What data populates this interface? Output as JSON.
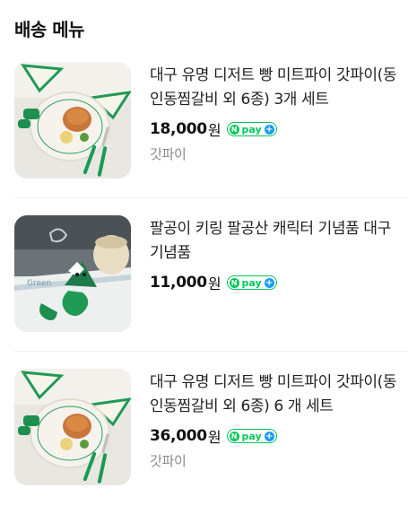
{
  "section": {
    "title": "배송 메뉴"
  },
  "items": [
    {
      "title": "대구 유명 디저트 빵 미트파이 갓파이(동인동찜갈비 외 6종) 3개 세트",
      "price": "18,000",
      "price_unit": "원",
      "npay": {
        "n": "N",
        "label": "pay",
        "plus": "+"
      },
      "seller": "갓파이",
      "image": "meat-pie-plate-photo"
    },
    {
      "title": "팔공이 키링 팔공산 캐릭터 기념품 대구 기념품",
      "price": "11,000",
      "price_unit": "원",
      "npay": {
        "n": "N",
        "label": "pay",
        "plus": "+"
      },
      "seller": "",
      "image": "green-mountain-keyring-photo"
    },
    {
      "title": "대구 유명 디저트 빵 미트파이 갓파이(동인동찜갈비 외 6종) 6 개 세트",
      "price": "36,000",
      "price_unit": "원",
      "npay": {
        "n": "N",
        "label": "pay",
        "plus": "+"
      },
      "seller": "갓파이",
      "image": "meat-pie-plate-photo"
    }
  ],
  "colors": {
    "npay_green": "#03c75a",
    "npay_blue": "#1a9bff",
    "seller_gray": "#8a8a8a"
  }
}
